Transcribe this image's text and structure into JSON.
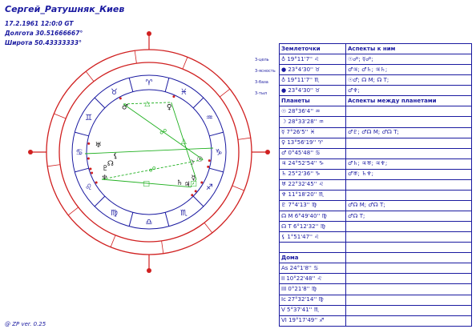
{
  "header": {
    "name": "Сергей_Ратушняк_Киев",
    "date": "17.2.1961 12:0:0 GT",
    "longitude": "Долгота 30.51666667°",
    "latitude": "Широта 50.43333333°"
  },
  "side_labels": [
    "3-цель",
    "3-ясность",
    "3-база",
    "3-тыл"
  ],
  "chart": {
    "signs": [
      "♈",
      "♉",
      "♊",
      "♋",
      "♌",
      "♍",
      "♎",
      "♏",
      "♐",
      "♑",
      "♒",
      "♓"
    ],
    "planets": [
      {
        "name": "sun-icon",
        "glyph": "☉"
      },
      {
        "name": "moon-icon",
        "glyph": "☽"
      },
      {
        "name": "mercury-icon",
        "glyph": "☿"
      },
      {
        "name": "venus-icon",
        "glyph": "♀"
      },
      {
        "name": "mars-icon",
        "glyph": "♂"
      },
      {
        "name": "jupiter-icon",
        "glyph": "♃"
      },
      {
        "name": "saturn-icon",
        "glyph": "♄"
      },
      {
        "name": "uranus-icon",
        "glyph": "♅"
      },
      {
        "name": "neptune-icon",
        "glyph": "♆"
      },
      {
        "name": "pluto-icon",
        "glyph": "♇"
      },
      {
        "name": "node-icon",
        "glyph": "☊"
      },
      {
        "name": "lilith-icon",
        "glyph": "⚸"
      }
    ],
    "aspect_glyphs": [
      "☍",
      "△",
      "△",
      "□",
      "□",
      "☍"
    ],
    "colors": {
      "ink": "#1a1aa0",
      "ring": "#d02020",
      "aspect": "#20b020",
      "marker": "#d02020"
    }
  },
  "table": {
    "sections": [
      {
        "header": [
          "Землеточки",
          "Аспекты к ним"
        ],
        "rows": [
          [
            "♁ 19°11'7'' ♌",
            "☉☍; ☿☍;"
          ],
          [
            "● 23°4'30'' ♉",
            "♂♃; ♂♄; ♃♄;"
          ],
          [
            "♁ 19°11'7'' ♏",
            "☉♂; ☊ M; ☊ T;"
          ],
          [
            "● 23°4'30'' ♉",
            "♂♆;"
          ]
        ]
      },
      {
        "header": [
          "Планеты",
          "Аспекты между планетами"
        ],
        "rows": [
          [
            "☉ 28°36'4'' ♒",
            ""
          ],
          [
            "☽ 28°33'28'' ♒",
            ""
          ],
          [
            "☿ 7°26'5'' ♓",
            "♂♇; ♂☊ M; ♂☊ T;"
          ],
          [
            "♀ 13°56'19'' ♈",
            ""
          ],
          [
            "♂ 0°45'48'' ♋",
            ""
          ],
          [
            "♃ 24°52'54'' ♑",
            "♂♄; ♃♅; ♃♆;"
          ],
          [
            "♄ 25°2'36'' ♑",
            "♂♅; ♄♆;"
          ],
          [
            "♅ 22°32'45'' ♌",
            ""
          ],
          [
            "♆ 11°18'20'' ♏",
            ""
          ],
          [
            "♇ 7°4'13'' ♍",
            "♂☊ M; ♂☊ T;"
          ],
          [
            "☊ M 6°49'40'' ♍",
            "♂☊ T;"
          ],
          [
            "☊ T 6°12'32'' ♍",
            ""
          ],
          [
            "⚸ 1°51'47'' ♌",
            ""
          ],
          [
            "",
            ""
          ]
        ]
      },
      {
        "header": [
          "Дома",
          ""
        ],
        "rows": [
          [
            "As 24°1'8'' ♋",
            ""
          ],
          [
            "II 10°22'48'' ♌",
            ""
          ],
          [
            "III 0°21'8'' ♍",
            ""
          ],
          [
            "Ic 27°32'14'' ♍",
            ""
          ],
          [
            "V 5°37'41'' ♏",
            ""
          ],
          [
            "VI 19°17'49'' ♐",
            ""
          ]
        ]
      }
    ]
  },
  "footer": "@ ZP  ver. 0.25"
}
